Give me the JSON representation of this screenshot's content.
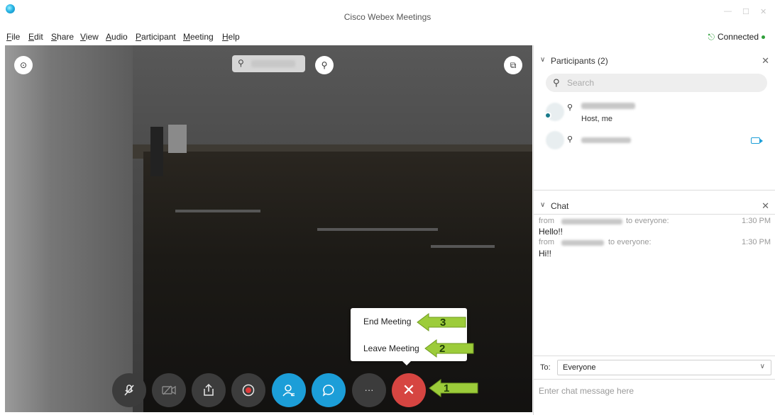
{
  "window": {
    "title": "Cisco Webex Meetings",
    "min": "—",
    "max": "☐",
    "close": "✕"
  },
  "menu": {
    "items": [
      {
        "u": "F",
        "rest": "ile"
      },
      {
        "u": "E",
        "rest": "dit"
      },
      {
        "u": "S",
        "rest": "hare"
      },
      {
        "u": "V",
        "rest": "iew"
      },
      {
        "u": "A",
        "rest": "udio"
      },
      {
        "u": "P",
        "rest": "articipant"
      },
      {
        "u": "M",
        "rest": "eeting"
      },
      {
        "u": "H",
        "rest": "elp"
      }
    ],
    "connection_status": "Connected"
  },
  "video": {
    "info_icon": "⊙",
    "pin_icon": "⚲",
    "layout_icon": "⧉"
  },
  "controls": {
    "more_label": "···",
    "end_label": "✕"
  },
  "popup": {
    "end_meeting": "End Meeting",
    "leave_meeting": "Leave Meeting"
  },
  "callouts": {
    "one": "1",
    "two": "2",
    "three": "3"
  },
  "participants": {
    "header": "Participants (2)",
    "search_placeholder": "Search",
    "rows": [
      {
        "role": "Host, me"
      },
      {
        "role": ""
      }
    ]
  },
  "chat": {
    "header": "Chat",
    "messages": [
      {
        "from": "from",
        "to": "to everyone:",
        "time": "1:30 PM",
        "text": "Hello!!"
      },
      {
        "from": "from",
        "to": "to everyone:",
        "time": "1:30 PM",
        "text": "Hi!!"
      }
    ],
    "to_label": "To:",
    "recipient": "Everyone",
    "input_placeholder": "Enter chat message here"
  },
  "colors": {
    "accent_blue": "#1c9ed8",
    "end_red": "#d64541",
    "callout_green": "#9ccc3a",
    "status_green": "#2f9f3a"
  }
}
